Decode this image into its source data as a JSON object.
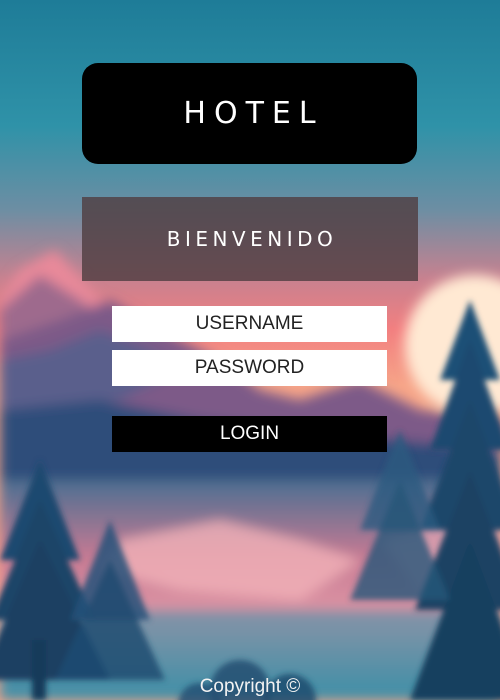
{
  "header": {
    "title": "HOTEL"
  },
  "welcome": {
    "text": "BIENVENIDO"
  },
  "login_form": {
    "username_placeholder": "USERNAME",
    "username_value": "",
    "password_placeholder": "PASSWORD",
    "password_value": "",
    "login_label": "LOGIN"
  },
  "footer": {
    "copyright": "Copyright ©"
  },
  "colors": {
    "title_box": "#000000",
    "welcome_box": "#503e42",
    "login_button": "#000000",
    "sky_top": "#1e7c98",
    "sky_horizon": "#f27f80",
    "sun": "#ffe9d3"
  }
}
